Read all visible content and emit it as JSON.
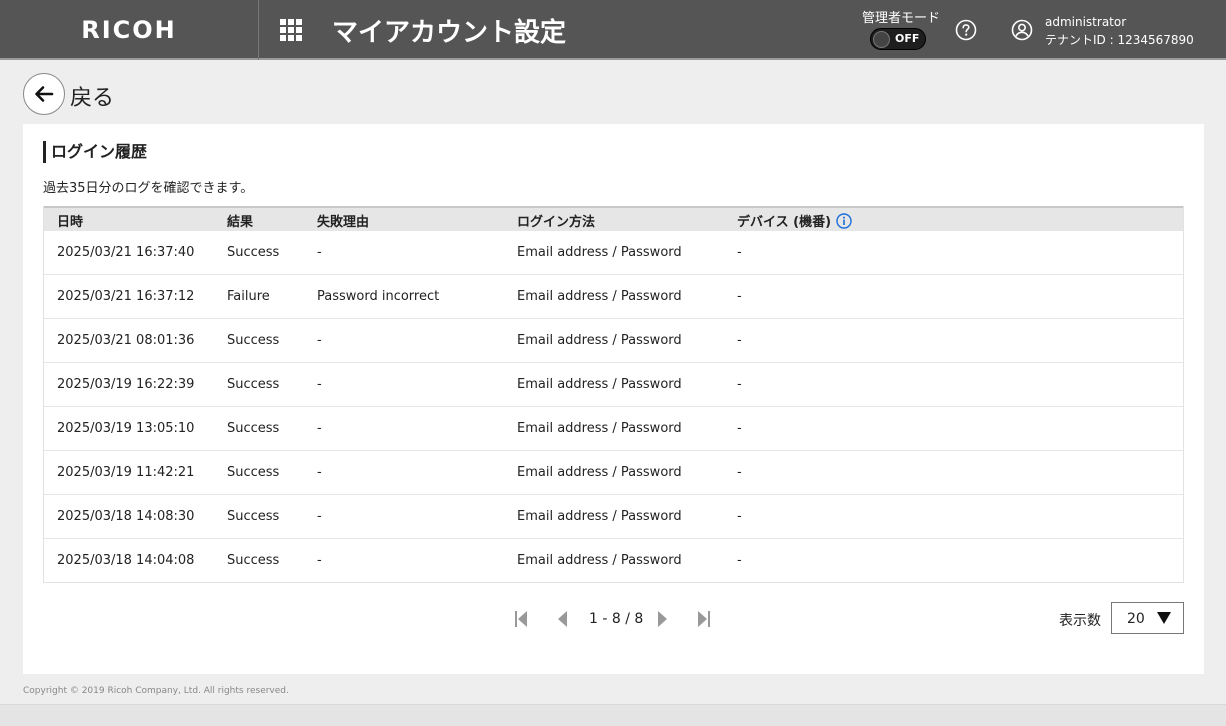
{
  "header": {
    "logo": "RICOH",
    "title": "マイアカウント設定",
    "admin_mode_label": "管理者モード",
    "admin_toggle_state": "OFF",
    "user_name": "administrator",
    "tenant_id": "テナントID : 1234567890"
  },
  "back": {
    "label": "戻る"
  },
  "section": {
    "title": "ログイン履歴",
    "description": "過去35日分のログを確認できます。"
  },
  "table": {
    "columns": [
      "日時",
      "結果",
      "失敗理由",
      "ログイン方法",
      "デバイス (機番)"
    ],
    "rows": [
      [
        "2025/03/21 16:37:40",
        "Success",
        "-",
        "Email address / Password",
        "-"
      ],
      [
        "2025/03/21 16:37:12",
        "Failure",
        "Password incorrect",
        "Email address / Password",
        "-"
      ],
      [
        "2025/03/21 08:01:36",
        "Success",
        "-",
        "Email address / Password",
        "-"
      ],
      [
        "2025/03/19 16:22:39",
        "Success",
        "-",
        "Email address / Password",
        "-"
      ],
      [
        "2025/03/19 13:05:10",
        "Success",
        "-",
        "Email address / Password",
        "-"
      ],
      [
        "2025/03/19 11:42:21",
        "Success",
        "-",
        "Email address / Password",
        "-"
      ],
      [
        "2025/03/18 14:08:30",
        "Success",
        "-",
        "Email address / Password",
        "-"
      ],
      [
        "2025/03/18 14:04:08",
        "Success",
        "-",
        "Email address / Password",
        "-"
      ]
    ]
  },
  "pagination": {
    "info": "1 - 8 / 8",
    "per_page_label": "表示数",
    "per_page_value": "20"
  },
  "footer": {
    "copyright": "Copyright © 2019 Ricoh Company, Ltd. All rights reserved."
  },
  "colors": {
    "header_bg": "#555555",
    "info_icon": "#1a6fd8"
  }
}
